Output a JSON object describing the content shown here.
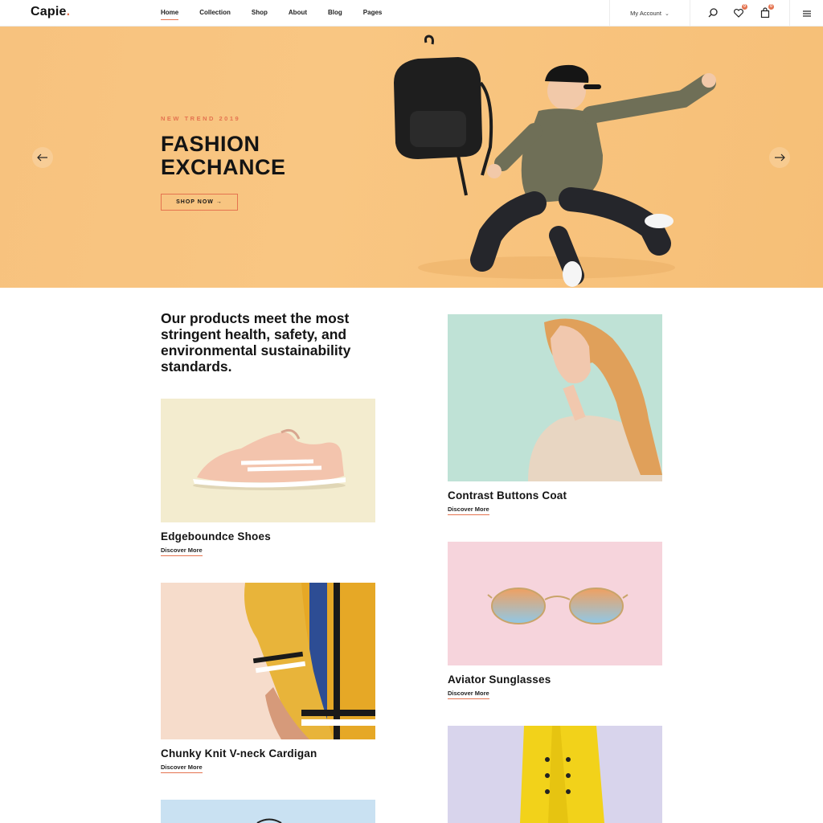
{
  "brand": {
    "name": "Capie",
    "dot": ".",
    "accent": "#e4734f"
  },
  "nav": {
    "items": [
      {
        "label": "Home",
        "active": true
      },
      {
        "label": "Collection",
        "active": false
      },
      {
        "label": "Shop",
        "active": false
      },
      {
        "label": "About",
        "active": false
      },
      {
        "label": "Blog",
        "active": false
      },
      {
        "label": "Pages",
        "active": false
      }
    ],
    "account_label": "My Account",
    "wishlist_count": "0",
    "cart_count": "0"
  },
  "hero": {
    "kicker": "NEW TREND 2019",
    "title_line1": "FASHION",
    "title_line2": "EXCHANCE",
    "button_label": "SHOP NOW →",
    "background": "#f8c47f"
  },
  "intro": {
    "text": "Our products meet the most stringent health, safety, and environmental sustainability standards."
  },
  "products": [
    {
      "title": "Edgeboundce Shoes",
      "link": "Discover More",
      "bg": "#f3eccf"
    },
    {
      "title": "Contrast Buttons Coat",
      "link": "Discover More",
      "bg": "#bfe2d6"
    },
    {
      "title": "Chunky Knit V-neck Cardigan",
      "link": "Discover More",
      "bg": "#f6dccb"
    },
    {
      "title": "Aviator Sunglasses",
      "link": "Discover More",
      "bg": "#f6d4dc"
    }
  ]
}
